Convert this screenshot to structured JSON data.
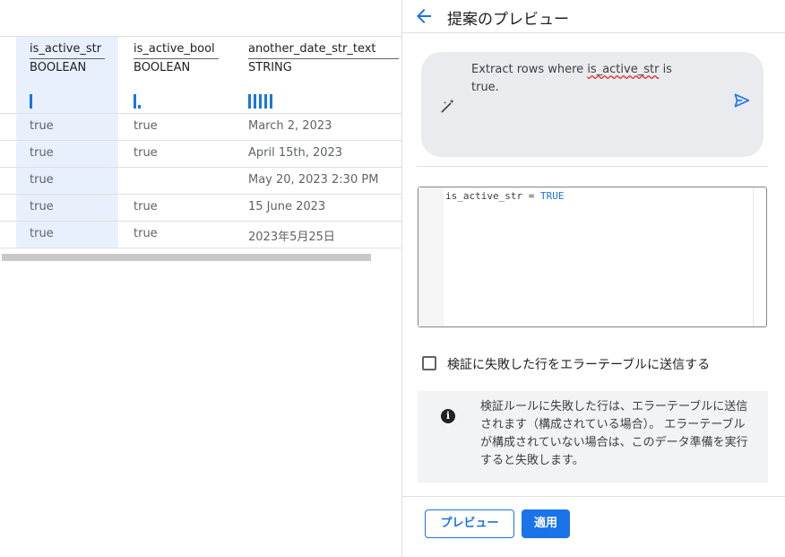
{
  "table": {
    "columns": [
      {
        "name": "is_active_str",
        "type": "BOOLEAN"
      },
      {
        "name": "is_active_bool",
        "type": "BOOLEAN"
      },
      {
        "name": "another_date_str_text",
        "type": "STRING"
      }
    ],
    "rows": [
      [
        "true",
        "true",
        "March 2, 2023"
      ],
      [
        "true",
        "true",
        "April 15th, 2023"
      ],
      [
        "true",
        "",
        "May 20, 2023 2:30 PM"
      ],
      [
        "true",
        "true",
        "15 June 2023"
      ],
      [
        "true",
        "true",
        "2023年5月25日"
      ]
    ]
  },
  "panel": {
    "title": "提案のプレビュー",
    "back_icon": "arrow-left-icon",
    "prompt": {
      "text_before": "Extract rows where ",
      "text_highlight": "is_active_str",
      "text_after": " is true.",
      "wand_icon": "magic-wand-icon",
      "send_icon": "send-icon"
    },
    "code": {
      "identifier": "is_active_str",
      "operator": " = ",
      "keyword": "TRUE"
    },
    "checkbox_label": "検証に失敗した行をエラーテーブルに送信する",
    "info_text": "検証ルールに失敗した行は、エラーテーブルに送信されます（構成されている場合）。 エラーテーブルが構成されていない場合は、このデータ準備を実行すると失敗します。",
    "info_icon": "info-icon",
    "buttons": {
      "preview": "プレビュー",
      "apply": "適用"
    }
  },
  "colors": {
    "accent": "#1a73e8",
    "highlight_column": "#e8f0fe",
    "prompt_bg": "#e9ebef",
    "info_bg": "#f1f3f4"
  }
}
